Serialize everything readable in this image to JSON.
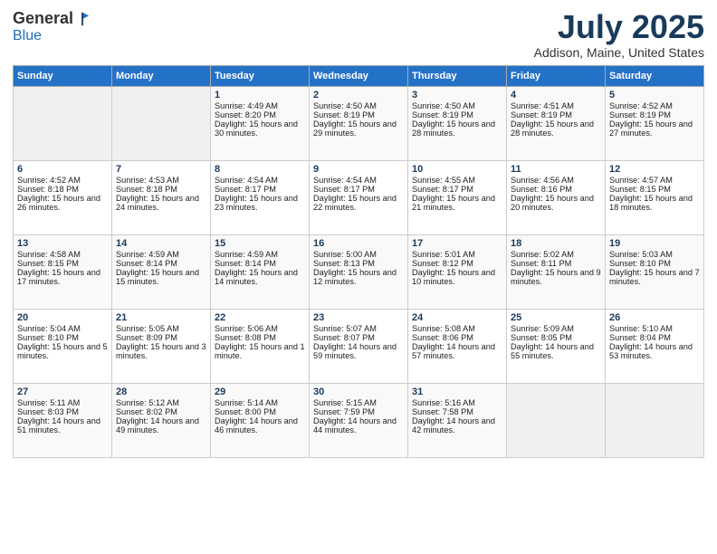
{
  "header": {
    "logo": {
      "general": "General",
      "blue": "Blue"
    },
    "title": "July 2025",
    "location": "Addison, Maine, United States"
  },
  "weekdays": [
    "Sunday",
    "Monday",
    "Tuesday",
    "Wednesday",
    "Thursday",
    "Friday",
    "Saturday"
  ],
  "weeks": [
    [
      {
        "day": "",
        "empty": true
      },
      {
        "day": "",
        "empty": true
      },
      {
        "day": "1",
        "sunrise": "Sunrise: 4:49 AM",
        "sunset": "Sunset: 8:20 PM",
        "daylight": "Daylight: 15 hours and 30 minutes."
      },
      {
        "day": "2",
        "sunrise": "Sunrise: 4:50 AM",
        "sunset": "Sunset: 8:19 PM",
        "daylight": "Daylight: 15 hours and 29 minutes."
      },
      {
        "day": "3",
        "sunrise": "Sunrise: 4:50 AM",
        "sunset": "Sunset: 8:19 PM",
        "daylight": "Daylight: 15 hours and 28 minutes."
      },
      {
        "day": "4",
        "sunrise": "Sunrise: 4:51 AM",
        "sunset": "Sunset: 8:19 PM",
        "daylight": "Daylight: 15 hours and 28 minutes."
      },
      {
        "day": "5",
        "sunrise": "Sunrise: 4:52 AM",
        "sunset": "Sunset: 8:19 PM",
        "daylight": "Daylight: 15 hours and 27 minutes."
      }
    ],
    [
      {
        "day": "6",
        "sunrise": "Sunrise: 4:52 AM",
        "sunset": "Sunset: 8:18 PM",
        "daylight": "Daylight: 15 hours and 26 minutes."
      },
      {
        "day": "7",
        "sunrise": "Sunrise: 4:53 AM",
        "sunset": "Sunset: 8:18 PM",
        "daylight": "Daylight: 15 hours and 24 minutes."
      },
      {
        "day": "8",
        "sunrise": "Sunrise: 4:54 AM",
        "sunset": "Sunset: 8:17 PM",
        "daylight": "Daylight: 15 hours and 23 minutes."
      },
      {
        "day": "9",
        "sunrise": "Sunrise: 4:54 AM",
        "sunset": "Sunset: 8:17 PM",
        "daylight": "Daylight: 15 hours and 22 minutes."
      },
      {
        "day": "10",
        "sunrise": "Sunrise: 4:55 AM",
        "sunset": "Sunset: 8:17 PM",
        "daylight": "Daylight: 15 hours and 21 minutes."
      },
      {
        "day": "11",
        "sunrise": "Sunrise: 4:56 AM",
        "sunset": "Sunset: 8:16 PM",
        "daylight": "Daylight: 15 hours and 20 minutes."
      },
      {
        "day": "12",
        "sunrise": "Sunrise: 4:57 AM",
        "sunset": "Sunset: 8:15 PM",
        "daylight": "Daylight: 15 hours and 18 minutes."
      }
    ],
    [
      {
        "day": "13",
        "sunrise": "Sunrise: 4:58 AM",
        "sunset": "Sunset: 8:15 PM",
        "daylight": "Daylight: 15 hours and 17 minutes."
      },
      {
        "day": "14",
        "sunrise": "Sunrise: 4:59 AM",
        "sunset": "Sunset: 8:14 PM",
        "daylight": "Daylight: 15 hours and 15 minutes."
      },
      {
        "day": "15",
        "sunrise": "Sunrise: 4:59 AM",
        "sunset": "Sunset: 8:14 PM",
        "daylight": "Daylight: 15 hours and 14 minutes."
      },
      {
        "day": "16",
        "sunrise": "Sunrise: 5:00 AM",
        "sunset": "Sunset: 8:13 PM",
        "daylight": "Daylight: 15 hours and 12 minutes."
      },
      {
        "day": "17",
        "sunrise": "Sunrise: 5:01 AM",
        "sunset": "Sunset: 8:12 PM",
        "daylight": "Daylight: 15 hours and 10 minutes."
      },
      {
        "day": "18",
        "sunrise": "Sunrise: 5:02 AM",
        "sunset": "Sunset: 8:11 PM",
        "daylight": "Daylight: 15 hours and 9 minutes."
      },
      {
        "day": "19",
        "sunrise": "Sunrise: 5:03 AM",
        "sunset": "Sunset: 8:10 PM",
        "daylight": "Daylight: 15 hours and 7 minutes."
      }
    ],
    [
      {
        "day": "20",
        "sunrise": "Sunrise: 5:04 AM",
        "sunset": "Sunset: 8:10 PM",
        "daylight": "Daylight: 15 hours and 5 minutes."
      },
      {
        "day": "21",
        "sunrise": "Sunrise: 5:05 AM",
        "sunset": "Sunset: 8:09 PM",
        "daylight": "Daylight: 15 hours and 3 minutes."
      },
      {
        "day": "22",
        "sunrise": "Sunrise: 5:06 AM",
        "sunset": "Sunset: 8:08 PM",
        "daylight": "Daylight: 15 hours and 1 minute."
      },
      {
        "day": "23",
        "sunrise": "Sunrise: 5:07 AM",
        "sunset": "Sunset: 8:07 PM",
        "daylight": "Daylight: 14 hours and 59 minutes."
      },
      {
        "day": "24",
        "sunrise": "Sunrise: 5:08 AM",
        "sunset": "Sunset: 8:06 PM",
        "daylight": "Daylight: 14 hours and 57 minutes."
      },
      {
        "day": "25",
        "sunrise": "Sunrise: 5:09 AM",
        "sunset": "Sunset: 8:05 PM",
        "daylight": "Daylight: 14 hours and 55 minutes."
      },
      {
        "day": "26",
        "sunrise": "Sunrise: 5:10 AM",
        "sunset": "Sunset: 8:04 PM",
        "daylight": "Daylight: 14 hours and 53 minutes."
      }
    ],
    [
      {
        "day": "27",
        "sunrise": "Sunrise: 5:11 AM",
        "sunset": "Sunset: 8:03 PM",
        "daylight": "Daylight: 14 hours and 51 minutes."
      },
      {
        "day": "28",
        "sunrise": "Sunrise: 5:12 AM",
        "sunset": "Sunset: 8:02 PM",
        "daylight": "Daylight: 14 hours and 49 minutes."
      },
      {
        "day": "29",
        "sunrise": "Sunrise: 5:14 AM",
        "sunset": "Sunset: 8:00 PM",
        "daylight": "Daylight: 14 hours and 46 minutes."
      },
      {
        "day": "30",
        "sunrise": "Sunrise: 5:15 AM",
        "sunset": "Sunset: 7:59 PM",
        "daylight": "Daylight: 14 hours and 44 minutes."
      },
      {
        "day": "31",
        "sunrise": "Sunrise: 5:16 AM",
        "sunset": "Sunset: 7:58 PM",
        "daylight": "Daylight: 14 hours and 42 minutes."
      },
      {
        "day": "",
        "empty": true
      },
      {
        "day": "",
        "empty": true
      }
    ]
  ]
}
